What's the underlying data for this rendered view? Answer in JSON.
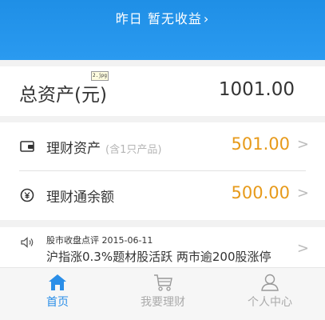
{
  "header": {
    "yesterday_text": "昨日 暂无收益",
    "chevron": "›"
  },
  "total": {
    "label": "总资产(元)",
    "badge": "2.jpg",
    "value": "1001.00"
  },
  "assets": {
    "items": [
      {
        "icon": "wallet-icon",
        "label": "理财资产",
        "sub": "(含1只产品)",
        "value": "501.00",
        "arrow": ">"
      },
      {
        "icon": "yen-coin-icon",
        "label": "理财通余额",
        "sub": "",
        "value": "500.00",
        "arrow": ">"
      }
    ]
  },
  "news": {
    "icon": "speaker-icon",
    "title": "股市收盘点评 2015-06-11",
    "body": "沪指涨0.3%题材股活跃 两市逾200股涨停",
    "arrow": ">"
  },
  "tabbar": {
    "items": [
      {
        "icon": "home-icon",
        "label": "首页",
        "active": true
      },
      {
        "icon": "cart-icon",
        "label": "我要理财",
        "active": false
      },
      {
        "icon": "person-icon",
        "label": "个人中心",
        "active": false
      }
    ]
  },
  "colors": {
    "header": "#2a9af0",
    "amount": "#e79a1a",
    "tab_active": "#2a8ee8",
    "tab_inactive": "#aaaaaa"
  }
}
